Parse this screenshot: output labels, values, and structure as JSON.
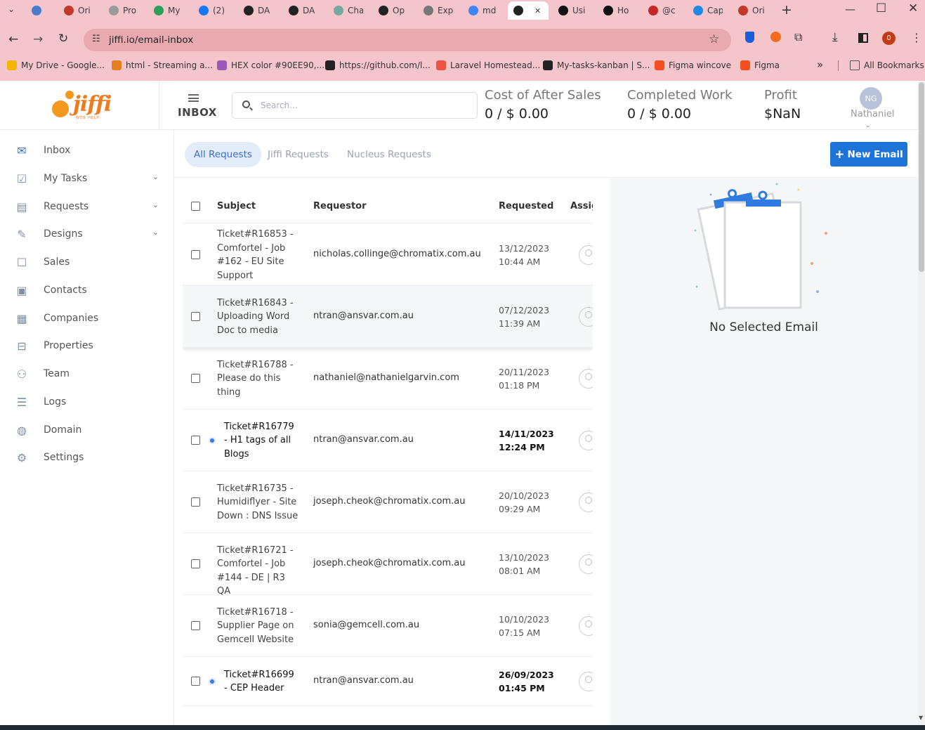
{
  "browser": {
    "tabs": [
      {
        "label": "",
        "color": "#4a7bd0"
      },
      {
        "label": "Ori",
        "color": "#c0392b"
      },
      {
        "label": "Pro",
        "color": "#9a9a9a"
      },
      {
        "label": "My",
        "color": "#2e9e5b"
      },
      {
        "label": "(2)",
        "color": "#1877f2"
      },
      {
        "label": "DA",
        "color": "#222222"
      },
      {
        "label": "DA",
        "color": "#222222"
      },
      {
        "label": "Cha",
        "color": "#74aa9c"
      },
      {
        "label": "Op",
        "color": "#222222"
      },
      {
        "label": "Exp",
        "color": "#777777"
      },
      {
        "label": "md",
        "color": "#4285f4"
      },
      {
        "label": "",
        "color": "#222222"
      },
      {
        "label": "Usi",
        "color": "#111111"
      },
      {
        "label": "Ho",
        "color": "#111111"
      },
      {
        "label": "@c",
        "color": "#c62828"
      },
      {
        "label": "Cap",
        "color": "#1e88e5"
      },
      {
        "label": "Ori",
        "color": "#c0392b"
      }
    ],
    "url": "jiffi.io/email-inbox",
    "bookmarks": [
      {
        "label": "My Drive - Google...",
        "color": "#f4b400"
      },
      {
        "label": "html - Streaming a...",
        "color": "#e67e22"
      },
      {
        "label": "HEX color #90EE90,...",
        "color": "#9b59b6"
      },
      {
        "label": "https://github.com/l...",
        "color": "#222222"
      },
      {
        "label": "Laravel Homestead...",
        "color": "#f05340"
      },
      {
        "label": "My-tasks-kanban | S...",
        "color": "#222222"
      },
      {
        "label": "Figma wincove",
        "color": "#f24e1e"
      },
      {
        "label": "Figma",
        "color": "#f24e1e"
      },
      {
        "label": "All Bookmarks",
        "color": "#555555"
      }
    ],
    "extension_badge": "0"
  },
  "header": {
    "logo_text": "jiffi",
    "logo_tag": "WEB HELP",
    "page_title": "INBOX",
    "search_placeholder": "Search...",
    "stats": [
      {
        "label": "Cost of After Sales",
        "value": "0 / $ 0.00"
      },
      {
        "label": "Completed Work",
        "value": "0 / $ 0.00"
      },
      {
        "label": "Profit",
        "value": "$NaN"
      }
    ],
    "user_initials": "NG",
    "user_name": "Nathaniel"
  },
  "sidebar": {
    "items": [
      {
        "label": "Inbox",
        "icon": "inbox-icon",
        "glyph": "✉",
        "has_chevron": false
      },
      {
        "label": "My Tasks",
        "icon": "clipboard-icon",
        "glyph": "☑",
        "has_chevron": true
      },
      {
        "label": "Requests",
        "icon": "request-icon",
        "glyph": "▤",
        "has_chevron": true
      },
      {
        "label": "Designs",
        "icon": "design-icon",
        "glyph": "✎",
        "has_chevron": true
      },
      {
        "label": "Sales",
        "icon": "sales-icon",
        "glyph": "☐",
        "has_chevron": false
      },
      {
        "label": "Contacts",
        "icon": "contacts-icon",
        "glyph": "▣",
        "has_chevron": false
      },
      {
        "label": "Companies",
        "icon": "companies-icon",
        "glyph": "▦",
        "has_chevron": false
      },
      {
        "label": "Properties",
        "icon": "properties-icon",
        "glyph": "⊟",
        "has_chevron": false
      },
      {
        "label": "Team",
        "icon": "team-icon",
        "glyph": "⚇",
        "has_chevron": false
      },
      {
        "label": "Logs",
        "icon": "logs-icon",
        "glyph": "☰",
        "has_chevron": false
      },
      {
        "label": "Domain",
        "icon": "globe-icon",
        "glyph": "◍",
        "has_chevron": false
      },
      {
        "label": "Settings",
        "icon": "gear-icon",
        "glyph": "⚙",
        "has_chevron": false
      }
    ]
  },
  "filters": {
    "tabs": [
      "All Requests",
      "Jiffi Requests",
      "Nucleus Requests"
    ],
    "active": "All Requests",
    "new_email_label": "New Email"
  },
  "table": {
    "columns": [
      "Subject",
      "Requestor",
      "Requested",
      "Assig"
    ],
    "rows": [
      {
        "subject": [
          "Ticket#R16853 -",
          "Comfortel - Job",
          "#162 - EU Site",
          "Support"
        ],
        "requestor": "nicholas.collinge@chromatix.com.au",
        "date": "13/12/2023",
        "time": "10:44 AM",
        "unread": false,
        "highlighted": false
      },
      {
        "subject": [
          "Ticket#R16843 -",
          "Uploading Word",
          "Doc to media"
        ],
        "requestor": "ntran@ansvar.com.au",
        "date": "07/12/2023",
        "time": "11:39 AM",
        "unread": false,
        "highlighted": true
      },
      {
        "subject": [
          "Ticket#R16788 -",
          "Please do this",
          "thing"
        ],
        "requestor": "nathaniel@nathanielgarvin.com",
        "date": "20/11/2023",
        "time": "01:18 PM",
        "unread": false,
        "highlighted": false
      },
      {
        "subject": [
          "Ticket#R16779",
          "- H1 tags of all",
          "Blogs"
        ],
        "requestor": "ntran@ansvar.com.au",
        "date": "14/11/2023",
        "time": "12:24 PM",
        "unread": true,
        "highlighted": false
      },
      {
        "subject": [
          "Ticket#R16735 -",
          "Humidiflyer - Site",
          "Down : DNS Issue"
        ],
        "requestor": "joseph.cheok@chromatix.com.au",
        "date": "20/10/2023",
        "time": "09:29 AM",
        "unread": false,
        "highlighted": false
      },
      {
        "subject": [
          "Ticket#R16721 -",
          "Comfortel - Job",
          "#144 - DE | R3 QA"
        ],
        "requestor": "joseph.cheok@chromatix.com.au",
        "date": "13/10/2023",
        "time": "08:01 AM",
        "unread": false,
        "highlighted": false
      },
      {
        "subject": [
          "Ticket#R16718 -",
          "Supplier Page on",
          "Gemcell Website"
        ],
        "requestor": "sonia@gemcell.com.au",
        "date": "10/10/2023",
        "time": "07:15 AM",
        "unread": false,
        "highlighted": false
      },
      {
        "subject": [
          "Ticket#R16699",
          "- CEP Header"
        ],
        "requestor": "ntran@ansvar.com.au",
        "date": "26/09/2023",
        "time": "01:45 PM",
        "unread": true,
        "highlighted": false
      }
    ]
  },
  "detail": {
    "empty_text": "No Selected Email"
  },
  "colors": {
    "accent": "#1e73d9",
    "brand": "#f07a1e",
    "chrome": "#f4c5cb"
  }
}
